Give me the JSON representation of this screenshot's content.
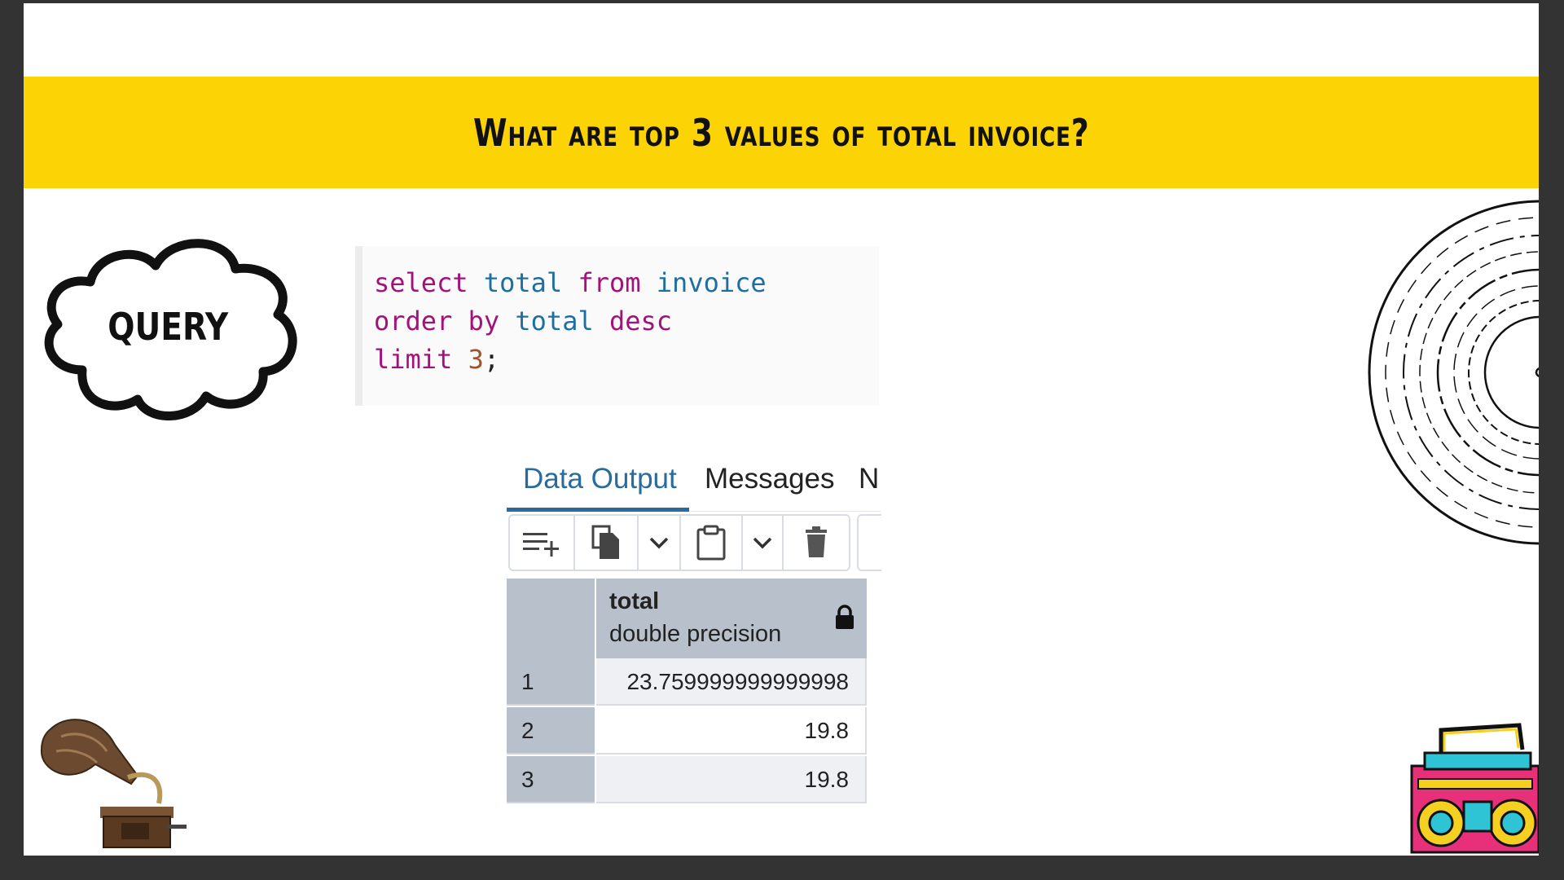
{
  "slide": {
    "title": "What are top 3 values of total invoice?",
    "cloud_label": "QUERY"
  },
  "code": {
    "lines": [
      [
        {
          "t": "select",
          "c": "kw"
        },
        {
          "t": " ",
          "c": "plain"
        },
        {
          "t": "total",
          "c": "id"
        },
        {
          "t": " ",
          "c": "plain"
        },
        {
          "t": "from",
          "c": "kw"
        },
        {
          "t": " ",
          "c": "plain"
        },
        {
          "t": "invoice",
          "c": "id"
        }
      ],
      [
        {
          "t": "order",
          "c": "kw"
        },
        {
          "t": " ",
          "c": "plain"
        },
        {
          "t": "by",
          "c": "kw"
        },
        {
          "t": " ",
          "c": "plain"
        },
        {
          "t": "total",
          "c": "id"
        },
        {
          "t": " ",
          "c": "plain"
        },
        {
          "t": "desc",
          "c": "kw"
        }
      ],
      [
        {
          "t": "limit",
          "c": "kw"
        },
        {
          "t": " ",
          "c": "plain"
        },
        {
          "t": "3",
          "c": "num"
        },
        {
          "t": ";",
          "c": "plain"
        }
      ]
    ]
  },
  "panel": {
    "tabs": [
      {
        "label": "Data Output",
        "active": true
      },
      {
        "label": "Messages",
        "active": false
      },
      {
        "label": "N",
        "active": false
      }
    ],
    "toolbar": [
      {
        "icon": "add-row-icon"
      },
      {
        "icon": "copy-icon"
      },
      {
        "icon": "chevron-down-icon"
      },
      {
        "icon": "paste-icon"
      },
      {
        "icon": "chevron-down-icon"
      },
      {
        "icon": "delete-icon"
      }
    ],
    "grid": {
      "column_name": "total",
      "column_type": "double precision",
      "rows": [
        {
          "index": "1",
          "value": "23.759999999999998"
        },
        {
          "index": "2",
          "value": "19.8"
        },
        {
          "index": "3",
          "value": "19.8"
        }
      ]
    }
  },
  "colors": {
    "banner": "#fcd304",
    "keyword": "#a2127a",
    "identifier": "#1e6fa1",
    "number": "#a0522d",
    "active_tab": "#2a6b9e",
    "grid_header": "#b8c0cc"
  }
}
